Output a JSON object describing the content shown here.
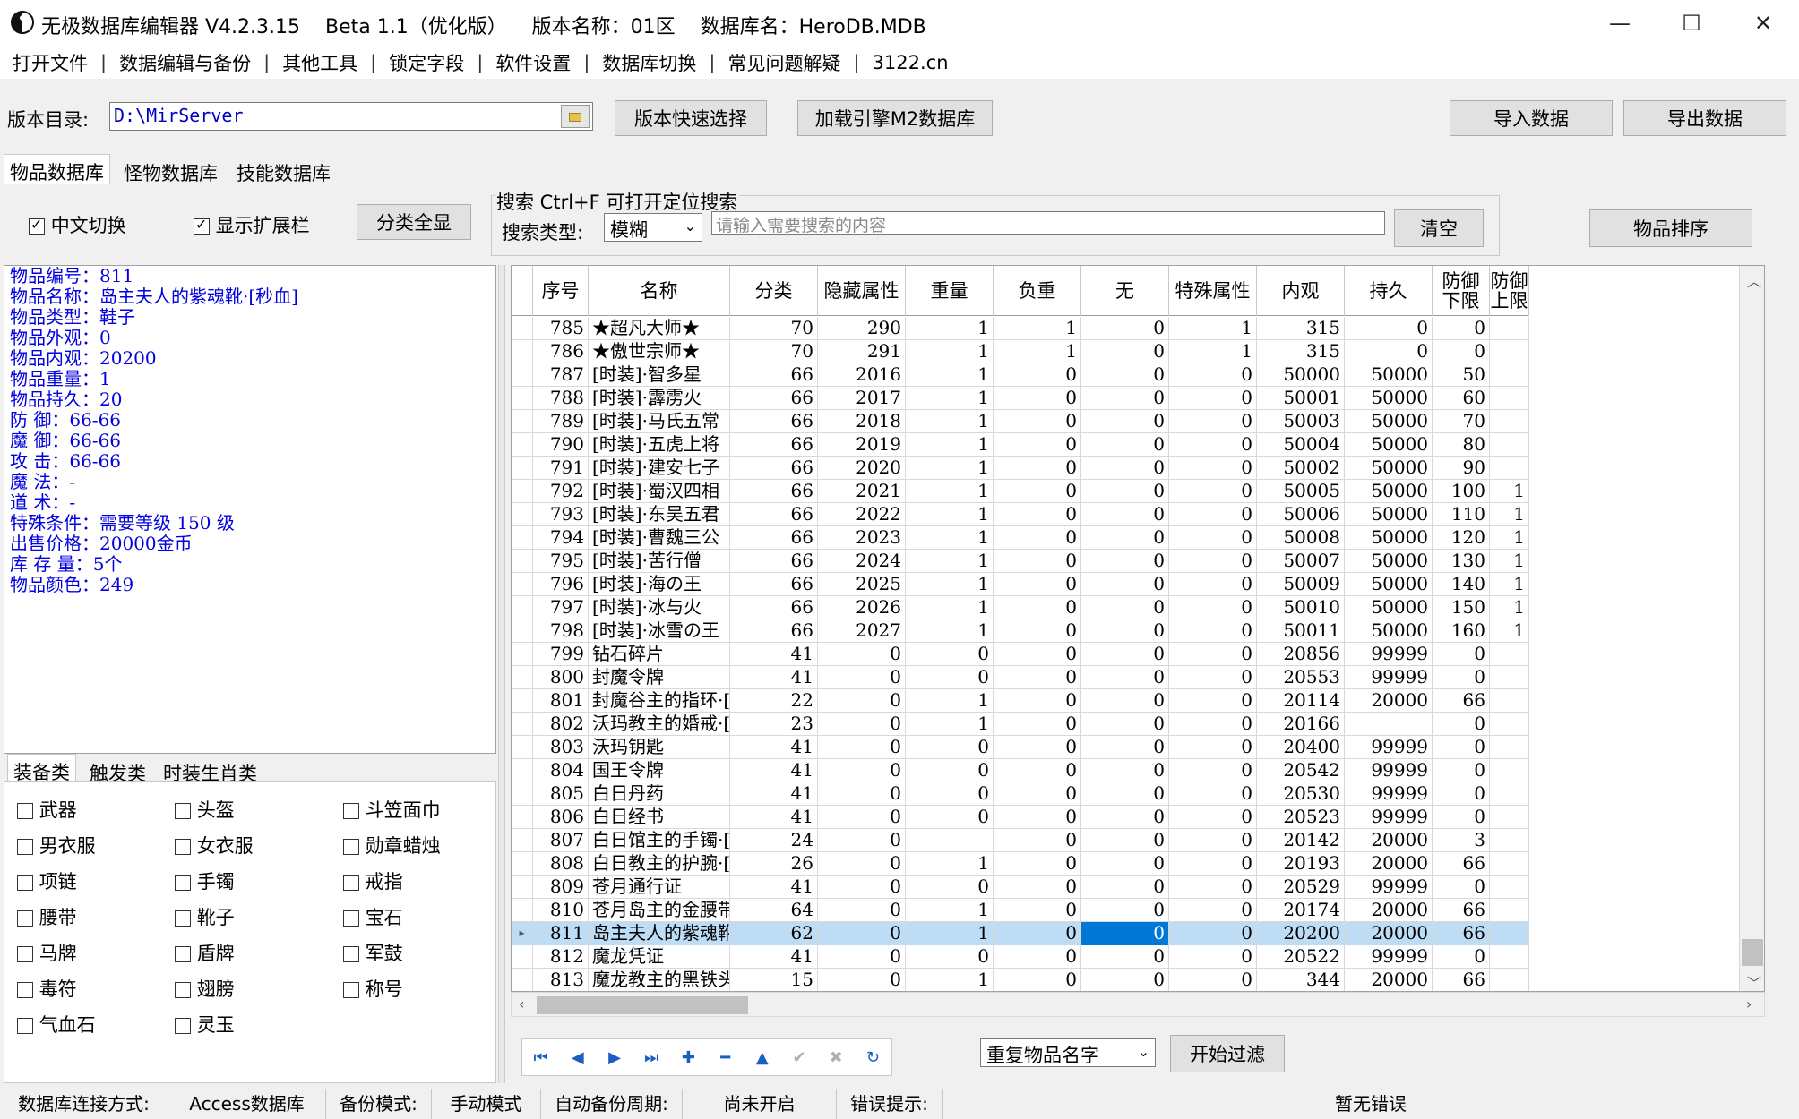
{
  "window": {
    "title": "无极数据库编辑器 V4.2.3.15    Beta 1.1（优化版）    版本名称：01区    数据库名：HeroDB.MDB"
  },
  "menu": [
    "打开文件",
    "数据编辑与备份",
    "其他工具",
    "锁定字段",
    "软件设置",
    "数据库切换",
    "常见问题解疑",
    "3122.cn"
  ],
  "toolbar": {
    "dir_label": "版本目录:",
    "dir_value": "D:\\MirServer",
    "quick_select": "版本快速选择",
    "load_m2": "加载引擎M2数据库",
    "import": "导入数据",
    "export": "导出数据"
  },
  "db_tabs": [
    "物品数据库",
    "怪物数据库",
    "技能数据库"
  ],
  "options": {
    "chinese_switch": "中文切换",
    "show_ext": "显示扩展栏",
    "show_all": "分类全显"
  },
  "search": {
    "title": "搜索    Ctrl+F 可打开定位搜索",
    "type_label": "搜索类型:",
    "type_value": "模糊",
    "placeholder": "请输入需要搜索的内容",
    "clear": "清空",
    "sort": "物品排序"
  },
  "info": [
    "物品编号：811",
    "物品名称：岛主夫人的紫魂靴·[秒血]",
    "物品类型：鞋子",
    "物品外观：0",
    "物品内观：20200",
    "物品重量：1",
    "物品持久：20",
    "防    御：66-66",
    "魔    御：66-66",
    "攻    击：66-66",
    "魔    法：-",
    "道    术：-",
    "特殊条件：需要等级 150 级",
    "出售价格：20000金币",
    "库 存 量：5个",
    "物品颜色：249"
  ],
  "cat_tabs": [
    "装备类",
    "触发类",
    "时装生肖类"
  ],
  "categories": [
    "武器",
    "头盔",
    "斗笠面巾",
    "男衣服",
    "女衣服",
    "勋章蜡烛",
    "项链",
    "手镯",
    "戒指",
    "腰带",
    "靴子",
    "宝石",
    "马牌",
    "盾牌",
    "军鼓",
    "毒符",
    "翅膀",
    "称号",
    "气血石",
    "灵玉"
  ],
  "grid": {
    "headers": [
      "序号",
      "名称",
      "分类",
      "隐藏属性",
      "重量",
      "负重",
      "无",
      "特殊属性",
      "内观",
      "持久",
      "防御\n下限",
      "防御\n上限"
    ],
    "rows": [
      [
        "785",
        "★超凡大师★",
        "70",
        "290",
        "1",
        "1",
        "0",
        "1",
        "315",
        "0",
        "0",
        ""
      ],
      [
        "786",
        "★傲世宗师★",
        "70",
        "291",
        "1",
        "1",
        "0",
        "1",
        "315",
        "0",
        "0",
        ""
      ],
      [
        "787",
        "[时装]·智多星",
        "66",
        "2016",
        "1",
        "0",
        "0",
        "0",
        "50000",
        "50000",
        "50",
        ""
      ],
      [
        "788",
        "[时装]·霹雳火",
        "66",
        "2017",
        "1",
        "0",
        "0",
        "0",
        "50001",
        "50000",
        "60",
        ""
      ],
      [
        "789",
        "[时装]·马氏五常",
        "66",
        "2018",
        "1",
        "0",
        "0",
        "0",
        "50003",
        "50000",
        "70",
        ""
      ],
      [
        "790",
        "[时装]·五虎上将",
        "66",
        "2019",
        "1",
        "0",
        "0",
        "0",
        "50004",
        "50000",
        "80",
        ""
      ],
      [
        "791",
        "[时装]·建安七子",
        "66",
        "2020",
        "1",
        "0",
        "0",
        "0",
        "50002",
        "50000",
        "90",
        ""
      ],
      [
        "792",
        "[时装]·蜀汉四相",
        "66",
        "2021",
        "1",
        "0",
        "0",
        "0",
        "50005",
        "50000",
        "100",
        "1"
      ],
      [
        "793",
        "[时装]·东吴五君",
        "66",
        "2022",
        "1",
        "0",
        "0",
        "0",
        "50006",
        "50000",
        "110",
        "1"
      ],
      [
        "794",
        "[时装]·曹魏三公",
        "66",
        "2023",
        "1",
        "0",
        "0",
        "0",
        "50008",
        "50000",
        "120",
        "1"
      ],
      [
        "795",
        "[时装]·苦行僧",
        "66",
        "2024",
        "1",
        "0",
        "0",
        "0",
        "50007",
        "50000",
        "130",
        "1"
      ],
      [
        "796",
        "[时装]·海の王",
        "66",
        "2025",
        "1",
        "0",
        "0",
        "0",
        "50009",
        "50000",
        "140",
        "1"
      ],
      [
        "797",
        "[时装]·冰与火",
        "66",
        "2026",
        "1",
        "0",
        "0",
        "0",
        "50010",
        "50000",
        "150",
        "1"
      ],
      [
        "798",
        "[时装]·冰雪の王",
        "66",
        "2027",
        "1",
        "0",
        "0",
        "0",
        "50011",
        "50000",
        "160",
        "1"
      ],
      [
        "799",
        "钻石碎片",
        "41",
        "0",
        "0",
        "0",
        "0",
        "0",
        "20856",
        "99999",
        "0",
        ""
      ],
      [
        "800",
        "封魔令牌",
        "41",
        "0",
        "0",
        "0",
        "0",
        "0",
        "20553",
        "99999",
        "0",
        ""
      ],
      [
        "801",
        "封魔谷主的指环·[",
        "22",
        "0",
        "1",
        "0",
        "0",
        "0",
        "20114",
        "20000",
        "66",
        ""
      ],
      [
        "802",
        "沃玛教主的婚戒·[",
        "23",
        "0",
        "1",
        "0",
        "0",
        "0",
        "20166",
        "",
        "0",
        ""
      ],
      [
        "803",
        "沃玛钥匙",
        "41",
        "0",
        "0",
        "0",
        "0",
        "0",
        "20400",
        "99999",
        "0",
        ""
      ],
      [
        "804",
        "国王令牌",
        "41",
        "0",
        "0",
        "0",
        "0",
        "0",
        "20542",
        "99999",
        "0",
        ""
      ],
      [
        "805",
        "白日丹药",
        "41",
        "0",
        "0",
        "0",
        "0",
        "0",
        "20530",
        "99999",
        "0",
        ""
      ],
      [
        "806",
        "白日经书",
        "41",
        "0",
        "0",
        "0",
        "0",
        "0",
        "20523",
        "99999",
        "0",
        ""
      ],
      [
        "807",
        "白日馆主的手镯·[",
        "24",
        "0",
        "",
        "0",
        "0",
        "0",
        "20142",
        "20000",
        "3",
        ""
      ],
      [
        "808",
        "白日教主的护腕·[",
        "26",
        "0",
        "1",
        "0",
        "0",
        "0",
        "20193",
        "20000",
        "66",
        ""
      ],
      [
        "809",
        "苍月通行证",
        "41",
        "0",
        "0",
        "0",
        "0",
        "0",
        "20529",
        "99999",
        "0",
        ""
      ],
      [
        "810",
        "苍月岛主的金腰带·",
        "64",
        "0",
        "1",
        "0",
        "0",
        "0",
        "20174",
        "20000",
        "66",
        ""
      ],
      [
        "811",
        "岛主夫人的紫魂靴·",
        "62",
        "0",
        "1",
        "0",
        "0",
        "0",
        "20200",
        "20000",
        "66",
        ""
      ],
      [
        "812",
        "魔龙凭证",
        "41",
        "0",
        "0",
        "0",
        "0",
        "0",
        "20522",
        "99999",
        "0",
        ""
      ],
      [
        "813",
        "魔龙教主的黑铁头·",
        "15",
        "0",
        "1",
        "0",
        "0",
        "0",
        "344",
        "20000",
        "66",
        ""
      ]
    ],
    "selected_row": 26
  },
  "filter": {
    "mode": "重复物品名字",
    "start": "开始过滤"
  },
  "status": {
    "conn_label": "数据库连接方式:",
    "conn_value": "Access数据库",
    "backup_label": "备份模式:",
    "backup_value": "手动模式",
    "auto_label": "自动备份周期:",
    "auto_value": "尚未开启",
    "err_label": "错误提示:",
    "err_value": "暂无错误"
  }
}
